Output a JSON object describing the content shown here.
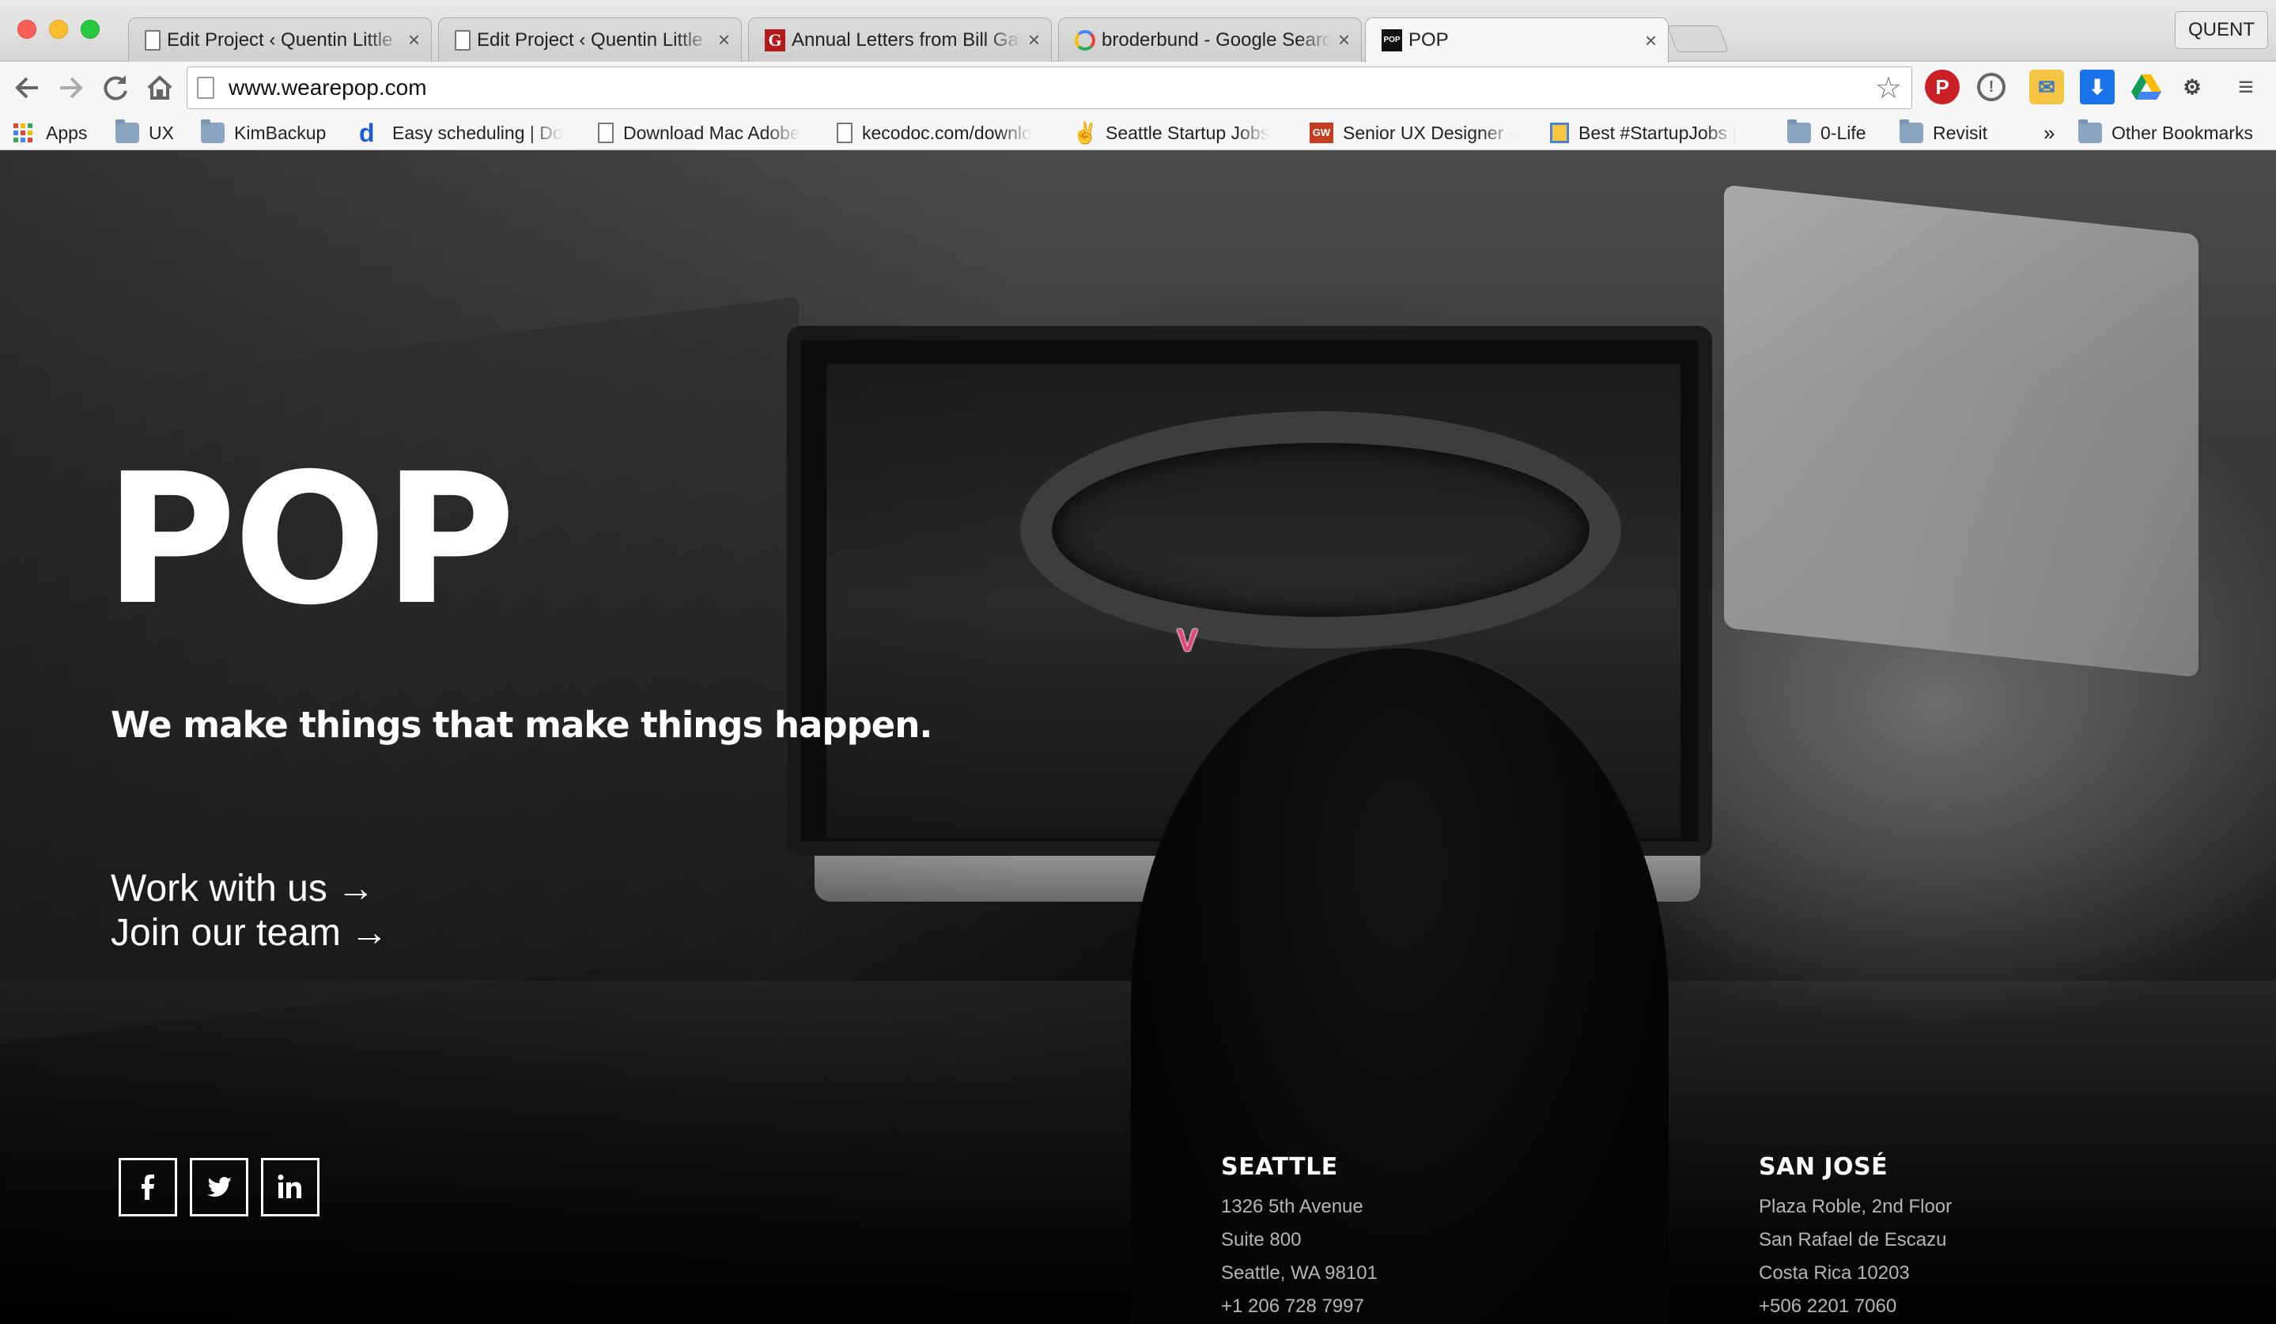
{
  "browser": {
    "tabs": [
      {
        "title": "Edit Project ‹ Quentin Little",
        "icon": "document-icon",
        "active": false
      },
      {
        "title": "Edit Project ‹ Quentin Little",
        "icon": "document-icon",
        "active": false
      },
      {
        "title": "Annual Letters from Bill Gat",
        "icon": "gates-notes-icon",
        "active": false
      },
      {
        "title": "broderbund - Google Searc",
        "icon": "google-icon",
        "active": false
      },
      {
        "title": "POP",
        "icon": "pop-icon",
        "active": true
      }
    ],
    "tab_close_glyph": "×",
    "profile_label": "QUENT",
    "url": "www.wearepop.com",
    "bookmarks": [
      {
        "label": "Apps",
        "icon": "apps-grid-icon"
      },
      {
        "label": "UX",
        "icon": "folder-icon"
      },
      {
        "label": "KimBackup",
        "icon": "folder-icon"
      },
      {
        "label": "Easy scheduling | Do",
        "icon": "doodle-icon"
      },
      {
        "label": "Download Mac Adobe",
        "icon": "document-icon"
      },
      {
        "label": "kecodoc.com/downlo",
        "icon": "document-icon"
      },
      {
        "label": "Seattle Startup Jobs",
        "icon": "peace-hand-icon"
      },
      {
        "label": "Senior UX Designer -",
        "icon": "gw-icon"
      },
      {
        "label": "Best #StartupJobs |",
        "icon": "startup-jobs-icon"
      },
      {
        "label": "0-Life",
        "icon": "folder-icon"
      },
      {
        "label": "Revisit",
        "icon": "folder-icon"
      },
      {
        "label": "Other Bookmarks",
        "icon": "folder-icon"
      }
    ],
    "bookmarks_overflow": "»",
    "colors": {
      "pinterest": "#cb2027",
      "drive_green": "#0f9d58",
      "download_blue": "#1a73e8"
    }
  },
  "page": {
    "logo": "POP",
    "tagline": "We make things that make things happen.",
    "cta_work": "Work with us",
    "cta_join": "Join our team",
    "arrow_glyph": "→",
    "badge_letter": "V",
    "social": [
      {
        "name": "facebook",
        "icon": "facebook-icon",
        "glyph": "f"
      },
      {
        "name": "twitter",
        "icon": "twitter-icon",
        "glyph": "twitter-bird"
      },
      {
        "name": "linkedin",
        "icon": "linkedin-icon",
        "glyph": "in"
      }
    ],
    "offices": {
      "seattle": {
        "name": "SEATTLE",
        "lines": [
          "1326 5th Avenue",
          "Suite 800",
          "Seattle, WA 98101",
          "+1 206 728 7997"
        ]
      },
      "sanjose": {
        "name": "SAN JOSÉ",
        "lines": [
          "Plaza Roble, 2nd Floor",
          "San Rafael de Escazu",
          "Costa Rica  10203",
          "+506 2201 7060"
        ]
      }
    },
    "colors": {
      "accent_badge": "#e8447a",
      "text": "#ffffff",
      "muted": "#b5b5b5"
    }
  }
}
